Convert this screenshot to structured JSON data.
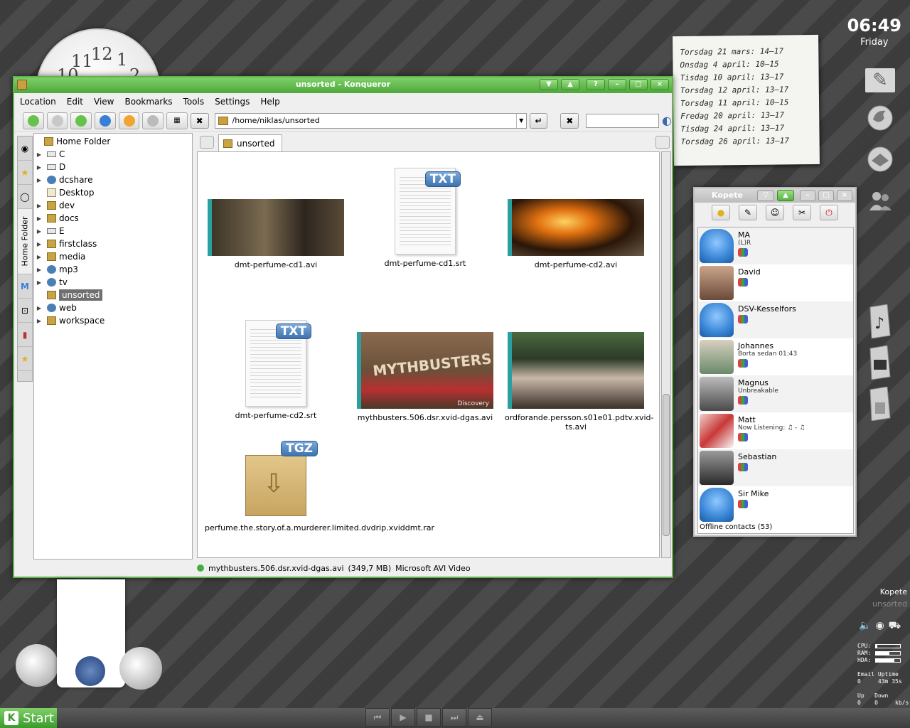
{
  "clock": {
    "time": "06:49",
    "day": "Friday",
    "numerals": [
      "11",
      "12",
      "1",
      "10",
      "2"
    ]
  },
  "note": {
    "lines": [
      "Torsdag 21 mars: 14–17",
      "Onsdag 4 april: 10–15",
      "Tisdag 10 april: 13–17",
      "Torsdag 12 april: 13–17",
      "Torsdag 11 april: 10–15",
      "Fredag 20 april: 13–17",
      "Tisdag 24 april: 13–17",
      "Torsdag 26 april: 13–17"
    ]
  },
  "konqueror": {
    "title": "unsorted - Konqueror",
    "menu": [
      "Location",
      "Edit",
      "View",
      "Bookmarks",
      "Tools",
      "Settings",
      "Help"
    ],
    "location_value": "/home/niklas/unsorted",
    "sidebar_tab_label": "Home Folder",
    "tree": {
      "root": "Home Folder",
      "items": [
        "C",
        "D",
        "dcshare",
        "Desktop",
        "dev",
        "docs",
        "E",
        "firstclass",
        "media",
        "mp3",
        "tv",
        "unsorted",
        "web",
        "workspace"
      ]
    },
    "tab_label": "unsorted",
    "files": [
      "dmt-perfume-cd1.avi",
      "dmt-perfume-cd1.srt",
      "dmt-perfume-cd2.avi",
      "dmt-perfume-cd2.srt",
      "mythbusters.506.dsr.xvid-dgas.avi",
      "ordforande.persson.s01e01.pdtv.xvid-ts.avi",
      "perfume.the.story.of.a.murderer.limited.dvdrip.xviddmt.rar"
    ],
    "badges": {
      "txt": "TXT",
      "tgz": "TGZ"
    },
    "thumb_text": {
      "mythbusters": "MYTHBUSTERS",
      "discovery": "Discovery"
    },
    "status_name": "mythbusters.506.dsr.xvid-dgas.avi",
    "status_size": "(349,7 MB)",
    "status_type": "Microsoft AVI Video"
  },
  "kopete": {
    "title": "Kopete",
    "contacts": [
      {
        "name": "MA",
        "status": "(L)R"
      },
      {
        "name": "David",
        "status": ""
      },
      {
        "name": "DSV-Kesselfors",
        "status": ""
      },
      {
        "name": "Johannes",
        "status": "Borta sedan 01:43"
      },
      {
        "name": "Magnus",
        "status": "Unbreakable"
      },
      {
        "name": "Matt",
        "status": "Now Listening: ♫ - ♫"
      },
      {
        "name": "Sebastian",
        "status": ""
      },
      {
        "name": "Sir Mike",
        "status": ""
      }
    ],
    "offline": "Offline contacts (53)"
  },
  "taskbar": {
    "start": "Start",
    "tasks": [
      "Kopete",
      "unsorted"
    ]
  },
  "sysmon": {
    "cpu_label": "CPU:",
    "ram_label": "RAM:",
    "hda_label": "HDA:",
    "cpu": 0.05,
    "ram": 0.55,
    "hda": 0.75,
    "email_label": "Email",
    "uptime_label": "Uptime",
    "email_value": "0",
    "uptime_value": "43m 35s",
    "up_label": "Up",
    "down_label": "Down",
    "up_value": "0",
    "down_value": "0",
    "unit": "kb/s"
  }
}
